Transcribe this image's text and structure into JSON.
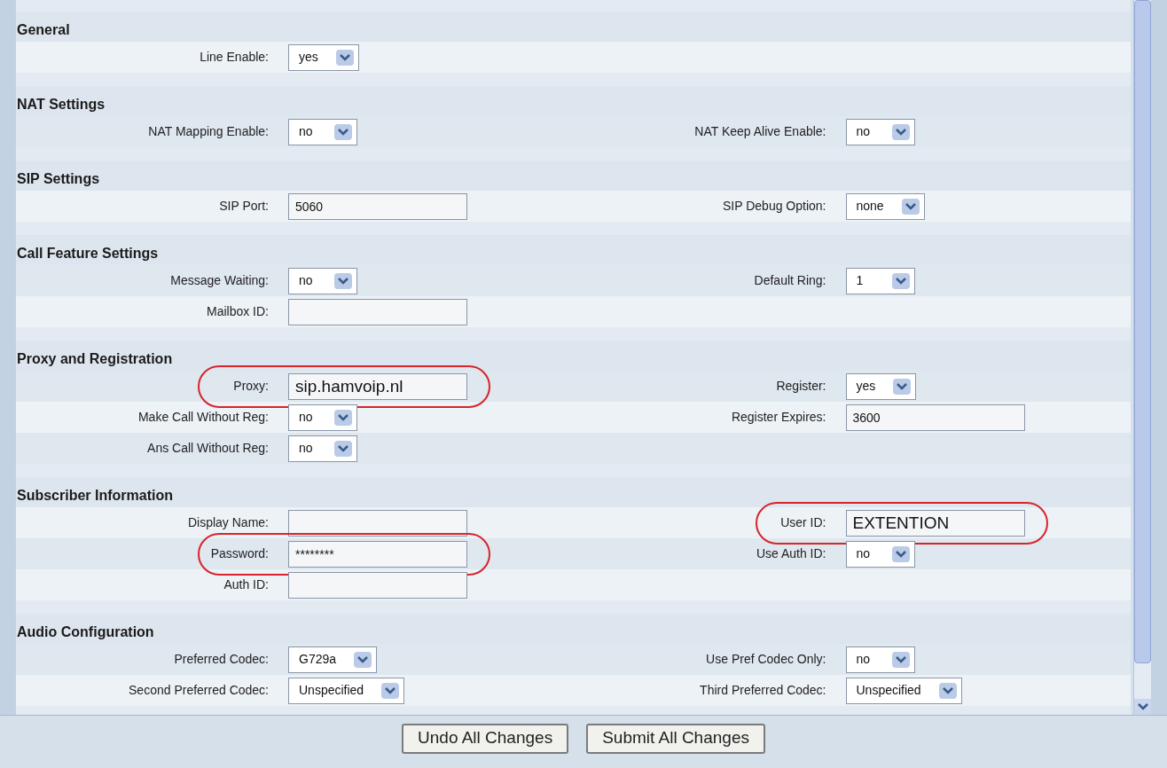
{
  "sections": [
    {
      "title": "General",
      "rows": [
        {
          "left": {
            "label": "Line Enable:",
            "kind": "select",
            "value": "yes",
            "highlighted": false
          }
        }
      ]
    },
    {
      "title": "NAT Settings",
      "rows": [
        {
          "left": {
            "label": "NAT Mapping Enable:",
            "kind": "select",
            "value": "no",
            "highlighted": false
          },
          "right": {
            "label": "NAT Keep Alive Enable:",
            "kind": "select",
            "value": "no",
            "highlighted": false
          }
        }
      ]
    },
    {
      "title": "SIP Settings",
      "rows": [
        {
          "left": {
            "label": "SIP Port:",
            "kind": "text",
            "value": "5060",
            "highlighted": false
          },
          "right": {
            "label": "SIP Debug Option:",
            "kind": "select",
            "value": "none",
            "highlighted": false
          }
        }
      ]
    },
    {
      "title": "Call Feature Settings",
      "rows": [
        {
          "left": {
            "label": "Message Waiting:",
            "kind": "select",
            "value": "no",
            "highlighted": false
          },
          "right": {
            "label": "Default Ring:",
            "kind": "select",
            "value": "1",
            "highlighted": false
          }
        },
        {
          "left": {
            "label": "Mailbox ID:",
            "kind": "text",
            "highlighted": false
          }
        }
      ]
    },
    {
      "title": "Proxy and Registration",
      "rows": [
        {
          "left": {
            "label": "Proxy:",
            "kind": "text",
            "value": "sip.hamvoip.nl",
            "highlighted": true
          },
          "right": {
            "label": "Register:",
            "kind": "select",
            "value": "yes",
            "highlighted": false
          }
        },
        {
          "left": {
            "label": "Make Call Without Reg:",
            "kind": "select",
            "value": "no",
            "highlighted": false
          },
          "right": {
            "label": "Register Expires:",
            "kind": "text",
            "value": "3600",
            "highlighted": false
          }
        },
        {
          "left": {
            "label": "Ans Call Without Reg:",
            "kind": "select",
            "value": "no",
            "highlighted": false
          }
        }
      ]
    },
    {
      "title": "Subscriber Information",
      "rows": [
        {
          "left": {
            "label": "Display Name:",
            "kind": "text",
            "highlighted": false
          },
          "right": {
            "label": "User ID:",
            "kind": "text",
            "value": "EXTENTION",
            "highlighted": true
          }
        },
        {
          "left": {
            "label": "Password:",
            "kind": "password",
            "value": "********",
            "highlighted": true
          },
          "right": {
            "label": "Use Auth ID:",
            "kind": "select",
            "value": "no",
            "highlighted": false
          }
        },
        {
          "left": {
            "label": "Auth ID:",
            "kind": "text",
            "highlighted": false
          }
        }
      ]
    },
    {
      "title": "Audio Configuration",
      "rows": [
        {
          "left": {
            "label": "Preferred Codec:",
            "kind": "select",
            "value": "G729a",
            "highlighted": false
          },
          "right": {
            "label": "Use Pref Codec Only:",
            "kind": "select",
            "value": "no",
            "highlighted": false
          }
        },
        {
          "left": {
            "label": "Second Preferred Codec:",
            "kind": "select",
            "value": "Unspecified",
            "highlighted": false
          },
          "right": {
            "label": "Third Preferred Codec:",
            "kind": "select",
            "value": "Unspecified",
            "highlighted": false
          }
        }
      ]
    }
  ],
  "buttons": [
    "Undo All Changes",
    "Submit All Changes"
  ]
}
